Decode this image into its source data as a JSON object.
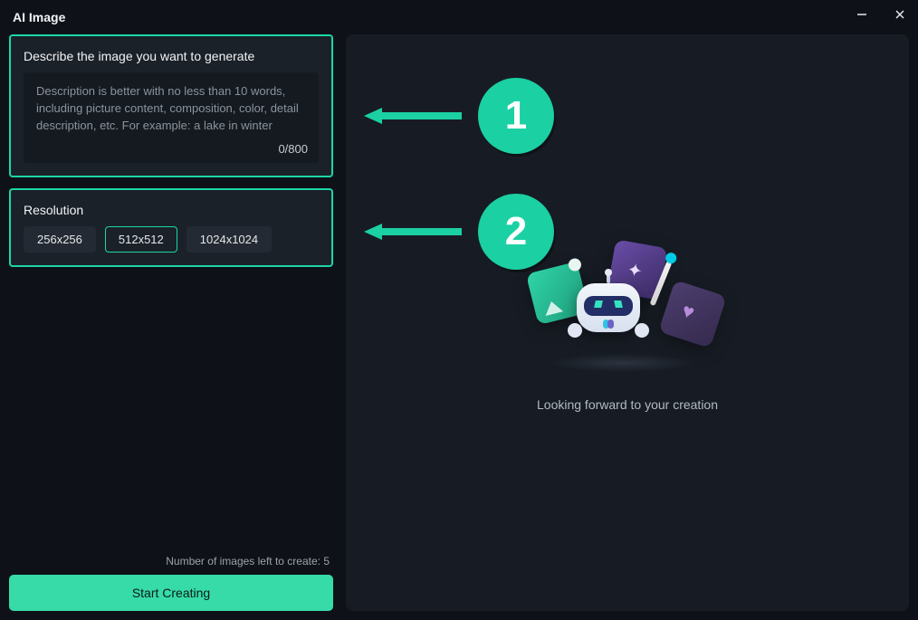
{
  "window": {
    "title": "AI Image"
  },
  "describe": {
    "heading": "Describe the image you want to generate",
    "placeholder": "Description is better with no less than 10 words, including picture content, composition, color, detail description, etc. For example: a lake in winter",
    "counter": "0/800"
  },
  "resolution": {
    "heading": "Resolution",
    "options": [
      "256x256",
      "512x512",
      "1024x1024"
    ],
    "selected_index": 1
  },
  "footer": {
    "images_left": "Number of images left to create: 5",
    "create_label": "Start Creating"
  },
  "preview": {
    "caption": "Looking forward to your creation"
  },
  "steps": {
    "one": "1",
    "two": "2"
  }
}
